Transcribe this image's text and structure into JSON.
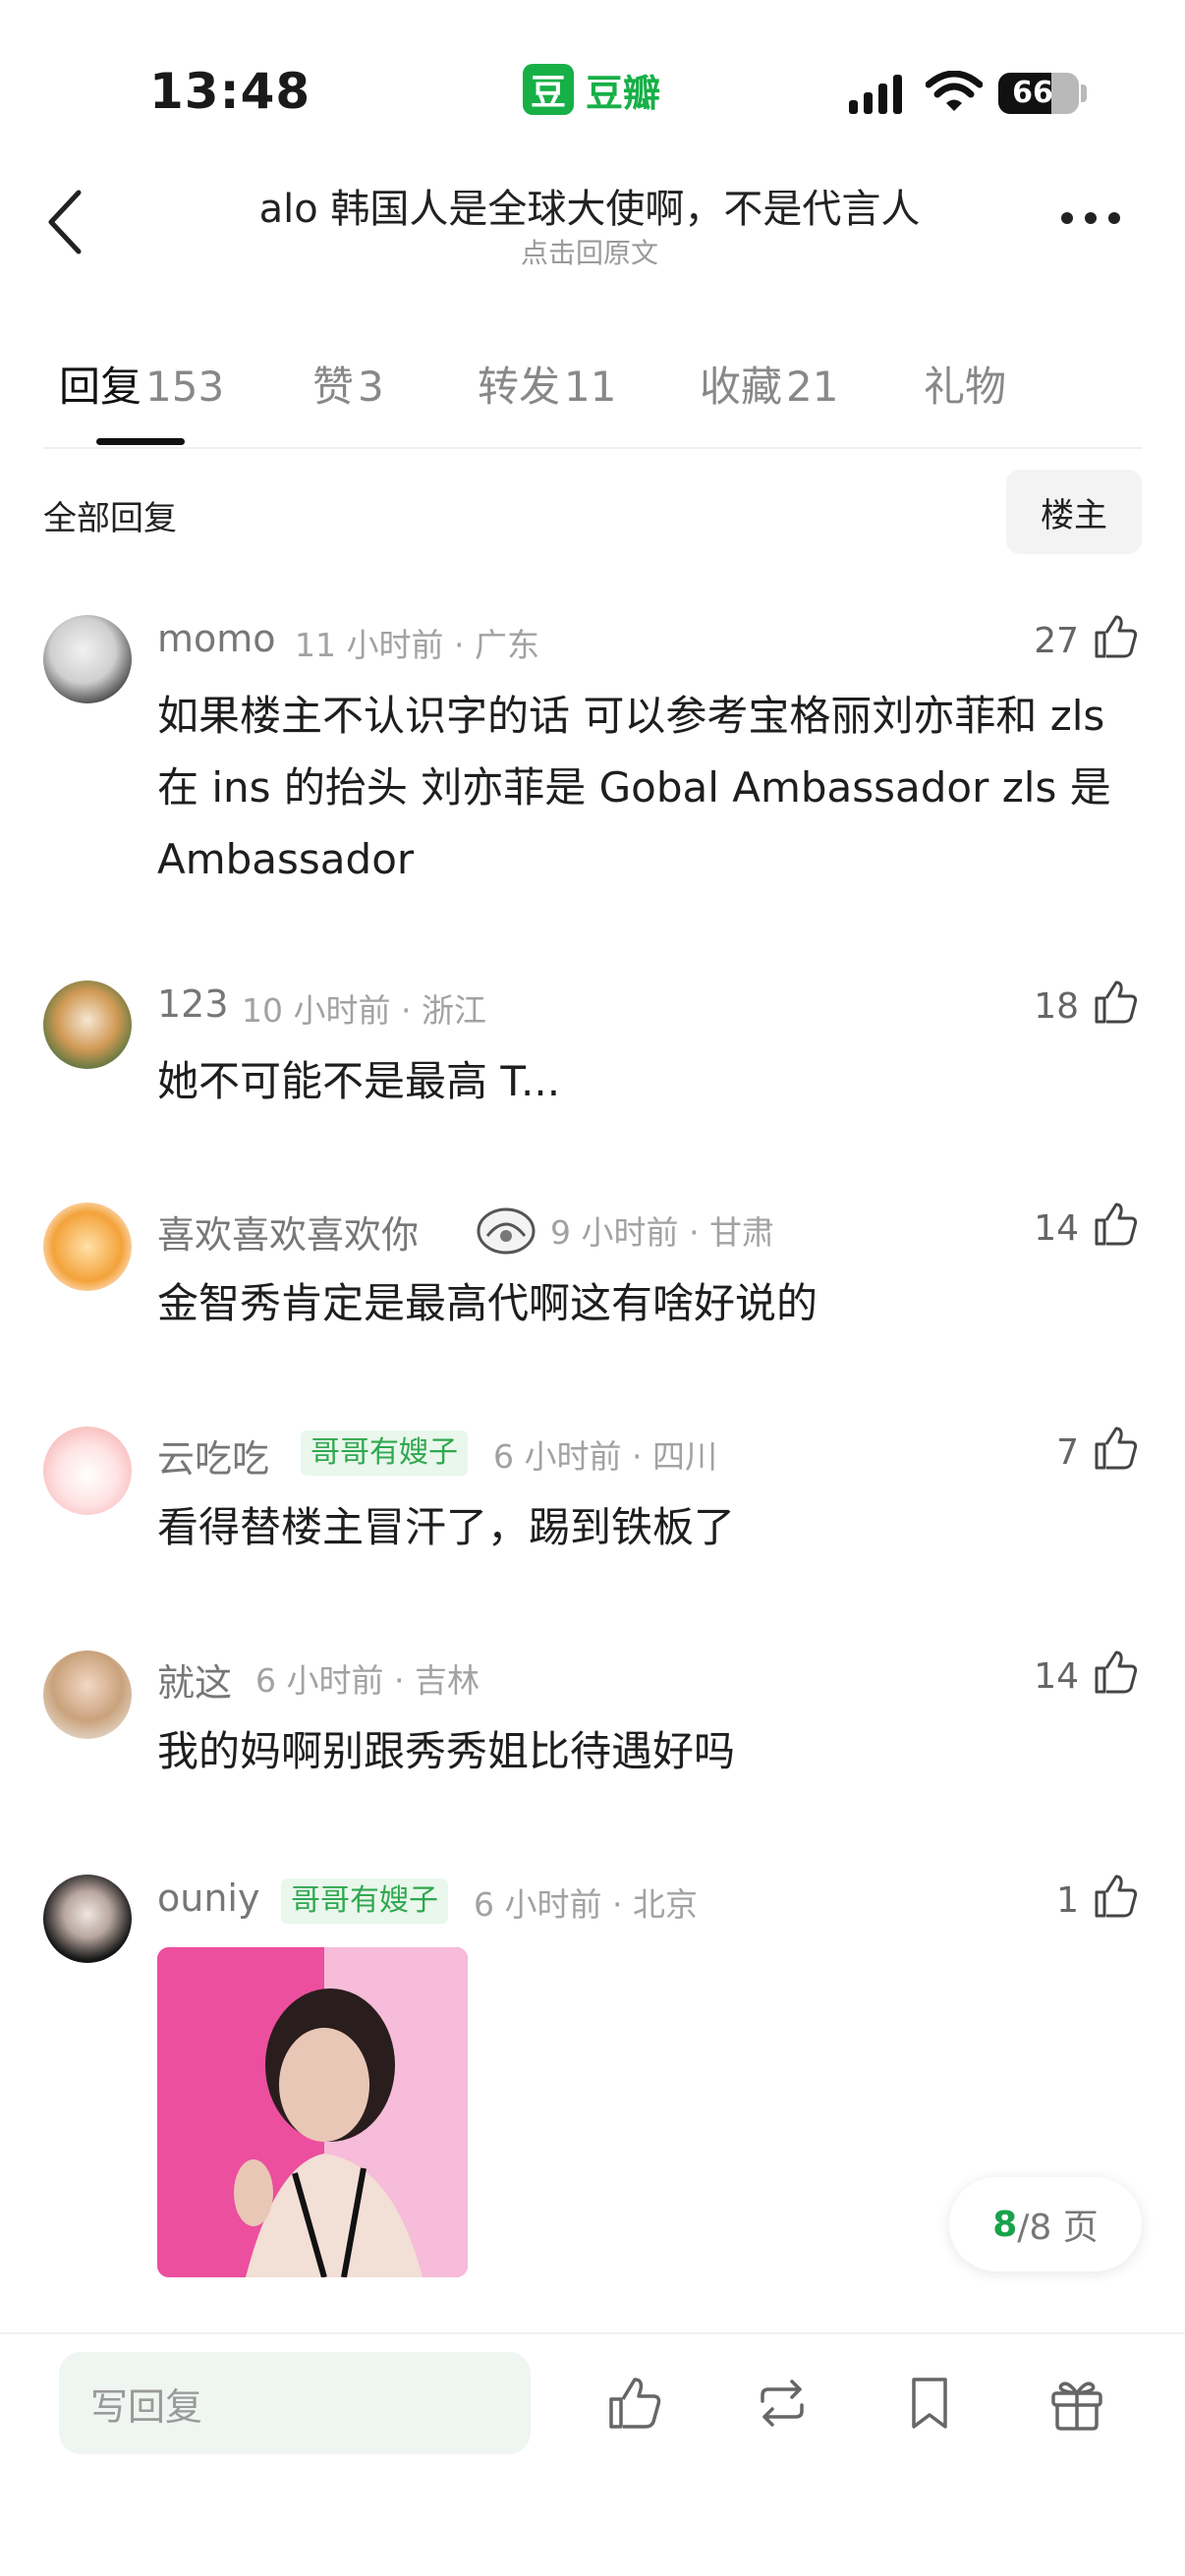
{
  "status_bar": {
    "time": "13:48",
    "app_logo": "豆",
    "app_name": "豆瓣",
    "battery": "66"
  },
  "header": {
    "title": "alo 韩国人是全球大使啊，不是代言人",
    "subtitle": "点击回原文"
  },
  "tabs": [
    {
      "label": "回复",
      "count": "153"
    },
    {
      "label": "赞",
      "count": "3"
    },
    {
      "label": "转发",
      "count": "11"
    },
    {
      "label": "收藏",
      "count": "21"
    },
    {
      "label": "礼物",
      "count": ""
    }
  ],
  "filter": {
    "label": "全部回复",
    "owner_button": "楼主"
  },
  "comments": [
    {
      "user": "momo",
      "badge": "",
      "meta": "11 小时前 · 广东",
      "likes": "27",
      "text": "如果楼主不认识字的话 可以参考宝格丽刘亦菲和 zls 在 ins 的抬头 刘亦菲是 Gobal Ambassador zls 是 Ambassador"
    },
    {
      "user": "123",
      "badge": "",
      "meta": "10 小时前 · 浙江",
      "likes": "18",
      "text": "她不可能不是最高 T..."
    },
    {
      "user": "喜欢喜欢喜欢你",
      "badge": "",
      "meta": "9 小时前 · 甘肃",
      "likes": "14",
      "text": "金智秀肯定是最高代啊这有啥好说的"
    },
    {
      "user": "云吃吃",
      "badge": "哥哥有嫂子",
      "meta": "6 小时前 · 四川",
      "likes": "7",
      "text": "看得替楼主冒汗了，踢到铁板了"
    },
    {
      "user": "就这",
      "badge": "",
      "meta": "6 小时前 · 吉林",
      "likes": "14",
      "text": "我的妈啊别跟秀秀姐比待遇好吗"
    },
    {
      "user": "ouniy",
      "badge": "哥哥有嫂子",
      "meta": "6 小时前 · 北京",
      "likes": "1",
      "text": ""
    }
  ],
  "pager": {
    "current": "8",
    "total": "/8 页"
  },
  "bottom_bar": {
    "reply_placeholder": "写回复"
  },
  "colors": {
    "brand_green": "#17b047",
    "badge_green": "#2fa84f",
    "badge_bg": "#eaf7ec"
  }
}
